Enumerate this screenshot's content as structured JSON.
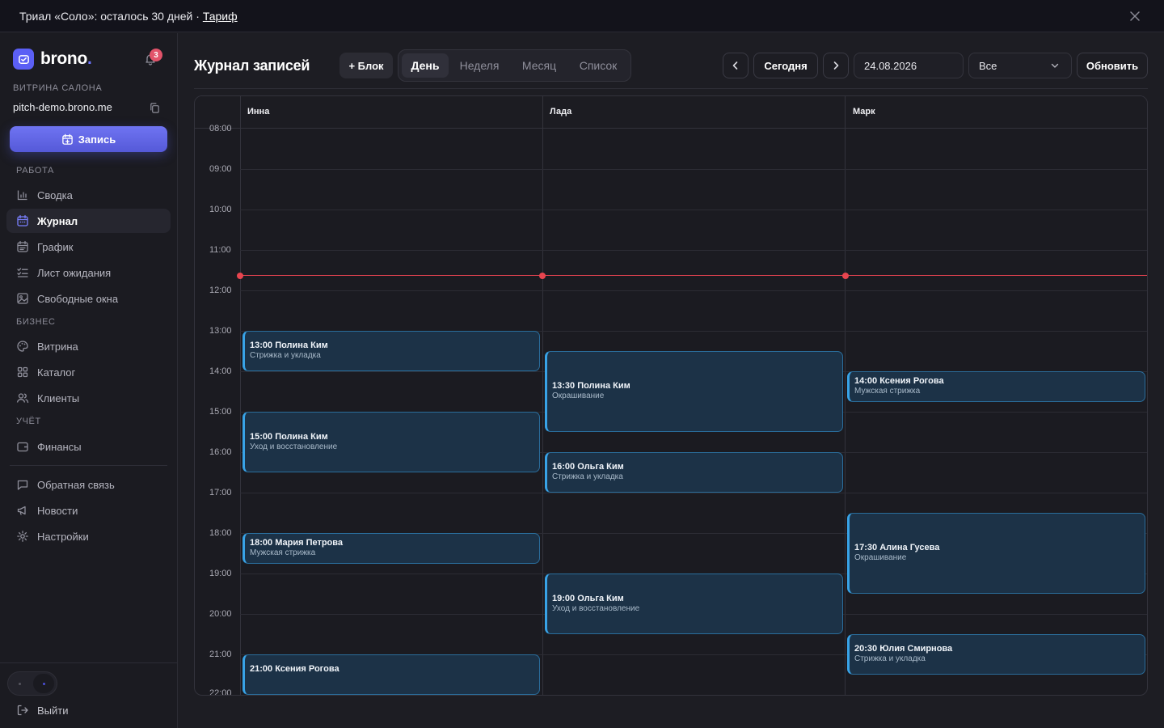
{
  "banner": {
    "text": "Триал «Соло»: осталось 30 дней · ",
    "link": "Тариф"
  },
  "brand": {
    "name": "brono",
    "dot": ".",
    "notifications": "3"
  },
  "vitrina": {
    "label": "ВИТРИНА САЛОНА",
    "url": "pitch-demo.brono.me"
  },
  "sidebar": {
    "new_button": "Запись",
    "section_work": "РАБОТА",
    "section_business": "БИЗНЕС",
    "section_accounting": "УЧЁТ",
    "items": [
      {
        "label": "Сводка",
        "icon": "chart-icon"
      },
      {
        "label": "Журнал",
        "icon": "calendar-icon"
      },
      {
        "label": "График",
        "icon": "schedule-icon"
      },
      {
        "label": "Лист ожидания",
        "icon": "checklist-icon"
      },
      {
        "label": "Свободные окна",
        "icon": "image-icon"
      },
      {
        "label": "Витрина",
        "icon": "palette-icon"
      },
      {
        "label": "Каталог",
        "icon": "grid-icon"
      },
      {
        "label": "Клиенты",
        "icon": "users-icon"
      },
      {
        "label": "Финансы",
        "icon": "wallet-icon"
      },
      {
        "label": "Обратная связь",
        "icon": "message-icon"
      },
      {
        "label": "Новости",
        "icon": "megaphone-icon"
      },
      {
        "label": "Настройки",
        "icon": "gear-icon"
      }
    ],
    "logout": "Выйти"
  },
  "header": {
    "title": "Журнал записей",
    "block_button": "+ Блок",
    "views": [
      "День",
      "Неделя",
      "Месяц",
      "Список"
    ],
    "active_view": "День",
    "today_button": "Сегодня",
    "date": "24.08.2026",
    "filter": "Все",
    "refresh_button": "Обновить"
  },
  "calendar": {
    "staff": [
      "Инна",
      "Лада",
      "Марк"
    ],
    "hours": [
      "08:00",
      "09:00",
      "10:00",
      "11:00",
      "12:00",
      "13:00",
      "14:00",
      "15:00",
      "16:00",
      "17:00",
      "18:00",
      "19:00",
      "20:00",
      "21:00",
      "22:00"
    ],
    "now_time": "11:37",
    "events": [
      {
        "staff": 0,
        "start": "13:00",
        "end": "14:00",
        "client": "Полина Ким",
        "service": "Стрижка и укладка"
      },
      {
        "staff": 0,
        "start": "15:00",
        "end": "16:30",
        "client": "Полина Ким",
        "service": "Уход и восстановление"
      },
      {
        "staff": 0,
        "start": "18:00",
        "end": "18:45",
        "client": "Мария Петрова",
        "service": "Мужская стрижка"
      },
      {
        "staff": 0,
        "start": "21:00",
        "end": "22:00",
        "client": "Ксения Рогова",
        "service": ""
      },
      {
        "staff": 1,
        "start": "13:30",
        "end": "15:30",
        "client": "Полина Ким",
        "service": "Окрашивание"
      },
      {
        "staff": 1,
        "start": "16:00",
        "end": "17:00",
        "client": "Ольга Ким",
        "service": "Стрижка и укладка"
      },
      {
        "staff": 1,
        "start": "19:00",
        "end": "20:30",
        "client": "Ольга Ким",
        "service": "Уход и восстановление"
      },
      {
        "staff": 2,
        "start": "14:00",
        "end": "14:45",
        "client": "Ксения Рогова",
        "service": "Мужская стрижка"
      },
      {
        "staff": 2,
        "start": "17:30",
        "end": "19:30",
        "client": "Алина Гусева",
        "service": "Окрашивание"
      },
      {
        "staff": 2,
        "start": "20:30",
        "end": "21:30",
        "client": "Юлия Смирнова",
        "service": "Стрижка и укладка"
      }
    ]
  },
  "colors": {
    "accent": "#5b5ff5",
    "event_border": "#38a3e7",
    "event_bg": "#1c3247",
    "now_line": "#e0414f",
    "badge": "#e2536a"
  }
}
